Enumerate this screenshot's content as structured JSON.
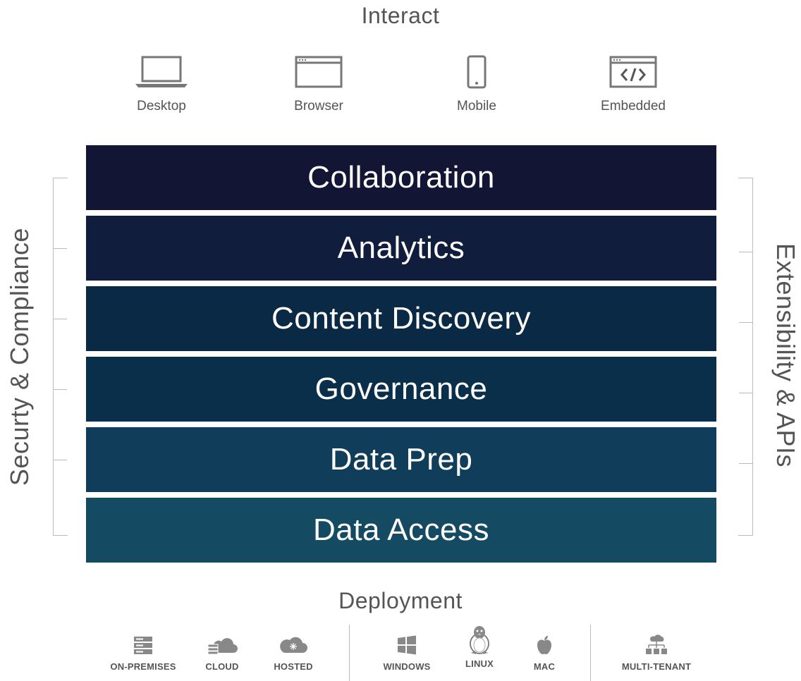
{
  "interact": {
    "title": "Interact",
    "items": [
      {
        "label": "Desktop",
        "icon": "laptop-icon"
      },
      {
        "label": "Browser",
        "icon": "browser-window-icon"
      },
      {
        "label": "Mobile",
        "icon": "mobile-phone-icon"
      },
      {
        "label": "Embedded",
        "icon": "embed-code-icon"
      }
    ]
  },
  "layers": [
    {
      "label": "Collaboration",
      "color": "#121634"
    },
    {
      "label": "Analytics",
      "color": "#111d3d"
    },
    {
      "label": "Content Discovery",
      "color": "#0a2944"
    },
    {
      "label": "Governance",
      "color": "#0a2f4b"
    },
    {
      "label": "Data Prep",
      "color": "#0f3d5a"
    },
    {
      "label": "Data Access",
      "color": "#144b63"
    }
  ],
  "side_left": "Securty & Compliance",
  "side_right": "Extensibility & APIs",
  "deployment": {
    "title": "Deployment",
    "items": [
      {
        "label": "ON-PREMISES",
        "icon": "server-rack-icon"
      },
      {
        "label": "CLOUD",
        "icon": "cloud-server-icon"
      },
      {
        "label": "HOSTED",
        "icon": "hosted-cloud-icon"
      },
      {
        "label": "WINDOWS",
        "icon": "windows-logo-icon"
      },
      {
        "label": "LINUX",
        "icon": "linux-penguin-icon"
      },
      {
        "label": "MAC",
        "icon": "apple-logo-icon"
      },
      {
        "label": "MULTI-TENANT",
        "icon": "multi-tenant-icon"
      }
    ]
  }
}
